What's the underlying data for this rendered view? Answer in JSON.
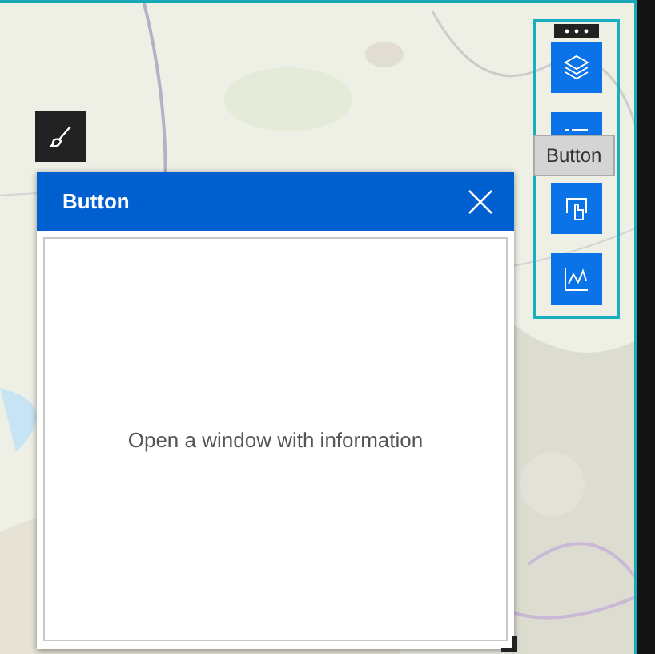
{
  "widget_panel": {
    "title": "Button",
    "body": "Open a window with information"
  },
  "tooltip": {
    "text": "Button"
  }
}
